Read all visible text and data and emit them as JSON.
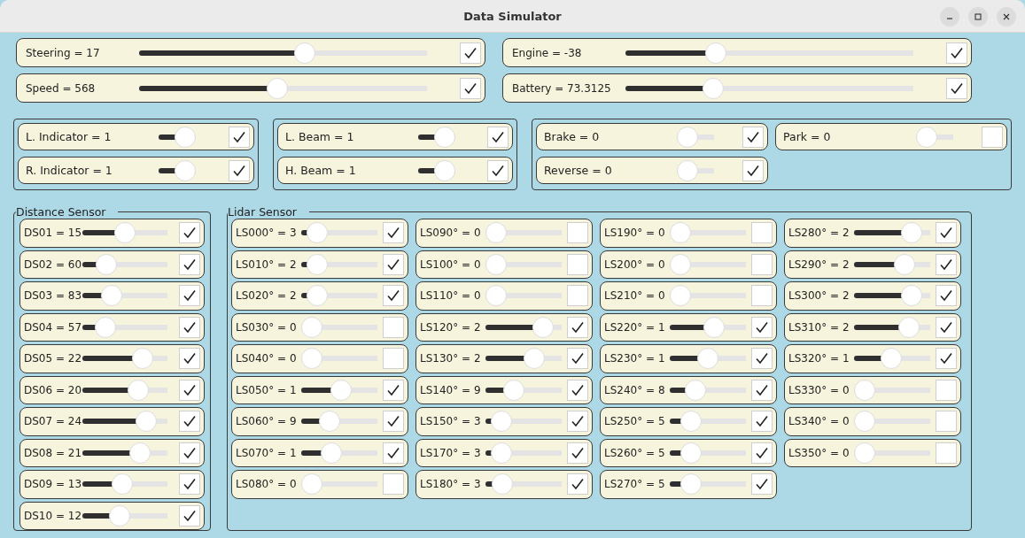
{
  "window": {
    "title": "Data Simulator"
  },
  "controls": [
    {
      "label": "Steering = 17",
      "level": 0.58,
      "checked": true
    },
    {
      "label": "Engine = -38",
      "level": 0.3,
      "checked": true
    },
    {
      "label": "Speed = 568",
      "level": 0.48,
      "checked": true
    },
    {
      "label": "Battery = 73.3125",
      "level": 0.29,
      "checked": true
    }
  ],
  "switch_groups": [
    {
      "rows": [
        {
          "label": "L. Indicator = 1",
          "level": 1,
          "checked": true
        },
        {
          "label": "R. Indicator = 1",
          "level": 1,
          "checked": true
        }
      ]
    },
    {
      "rows": [
        {
          "label": "L. Beam = 1",
          "level": 1,
          "checked": true
        },
        {
          "label": "H. Beam = 1",
          "level": 1,
          "checked": true
        }
      ]
    },
    {
      "rows": [
        {
          "label": "Brake = 0",
          "level": 0,
          "checked": true
        },
        {
          "label": "Park = 0",
          "level": 0,
          "checked": false
        },
        {
          "label": "Reverse = 0",
          "level": 0,
          "checked": true
        }
      ]
    }
  ],
  "distance_sensor": {
    "title": "Distance Sensor",
    "rows": [
      {
        "label": "DS01 = 15",
        "level": 0.5,
        "checked": true
      },
      {
        "label": "DS02 = 60",
        "level": 0.21,
        "checked": true
      },
      {
        "label": "DS03 = 83",
        "level": 0.29,
        "checked": true
      },
      {
        "label": "DS04 = 57",
        "level": 0.2,
        "checked": true
      },
      {
        "label": "DS05 = 22",
        "level": 0.78,
        "checked": true
      },
      {
        "label": "DS06 = 20",
        "level": 0.71,
        "checked": true
      },
      {
        "label": "DS07 = 24",
        "level": 0.83,
        "checked": true
      },
      {
        "label": "DS08 = 21",
        "level": 0.74,
        "checked": true
      },
      {
        "label": "DS09 = 13",
        "level": 0.46,
        "checked": true
      },
      {
        "label": "DS10 = 12",
        "level": 0.41,
        "checked": true
      }
    ]
  },
  "lidar_sensor": {
    "title": "Lidar Sensor",
    "rows": [
      {
        "label": "LS000° = 3",
        "level": 0.1,
        "checked": true
      },
      {
        "label": "LS010° = 2",
        "level": 0.1,
        "checked": true
      },
      {
        "label": "LS020° = 2",
        "level": 0.1,
        "checked": true
      },
      {
        "label": "LS030° = 0",
        "level": 0,
        "checked": false
      },
      {
        "label": "LS040° = 0",
        "level": 0,
        "checked": false
      },
      {
        "label": "LS050° = 1",
        "level": 0.54,
        "checked": true
      },
      {
        "label": "LS060° = 9",
        "level": 0.32,
        "checked": true
      },
      {
        "label": "LS070° = 1",
        "level": 0.36,
        "checked": true
      },
      {
        "label": "LS080° = 0",
        "level": 0,
        "checked": false
      },
      {
        "label": "LS090° = 0",
        "level": 0,
        "checked": false
      },
      {
        "label": "LS100° = 0",
        "level": 0,
        "checked": false
      },
      {
        "label": "LS110° = 0",
        "level": 0,
        "checked": false
      },
      {
        "label": "LS120° = 2",
        "level": 0.85,
        "checked": true
      },
      {
        "label": "LS130° = 2",
        "level": 0.7,
        "checked": true
      },
      {
        "label": "LS140° = 9",
        "level": 0.33,
        "checked": true
      },
      {
        "label": "LS150° = 3",
        "level": 0.1,
        "checked": true
      },
      {
        "label": "LS170° = 3",
        "level": 0.1,
        "checked": true
      },
      {
        "label": "LS180° = 3",
        "level": 0.12,
        "checked": true
      },
      {
        "label": "LS190° = 0",
        "level": 0,
        "checked": false
      },
      {
        "label": "LS200° = 0",
        "level": 0,
        "checked": false
      },
      {
        "label": "LS210° = 0",
        "level": 0,
        "checked": false
      },
      {
        "label": "LS220° = 1",
        "level": 0.62,
        "checked": true
      },
      {
        "label": "LS230° = 1",
        "level": 0.5,
        "checked": true
      },
      {
        "label": "LS240° = 8",
        "level": 0.28,
        "checked": true
      },
      {
        "label": "LS250° = 5",
        "level": 0.2,
        "checked": true
      },
      {
        "label": "LS260° = 5",
        "level": 0.2,
        "checked": true
      },
      {
        "label": "LS270° = 5",
        "level": 0.2,
        "checked": true
      },
      {
        "label": "LS280° = 2",
        "level": 0.86,
        "checked": true
      },
      {
        "label": "LS290° = 2",
        "level": 0.73,
        "checked": true
      },
      {
        "label": "LS300° = 2",
        "level": 0.85,
        "checked": true
      },
      {
        "label": "LS310° = 2",
        "level": 0.8,
        "checked": true
      },
      {
        "label": "LS320° = 1",
        "level": 0.48,
        "checked": true
      },
      {
        "label": "LS330° = 0",
        "level": 0,
        "checked": false
      },
      {
        "label": "LS340° = 0",
        "level": 0,
        "checked": false
      },
      {
        "label": "LS350° = 0",
        "level": 0,
        "checked": false
      }
    ]
  }
}
